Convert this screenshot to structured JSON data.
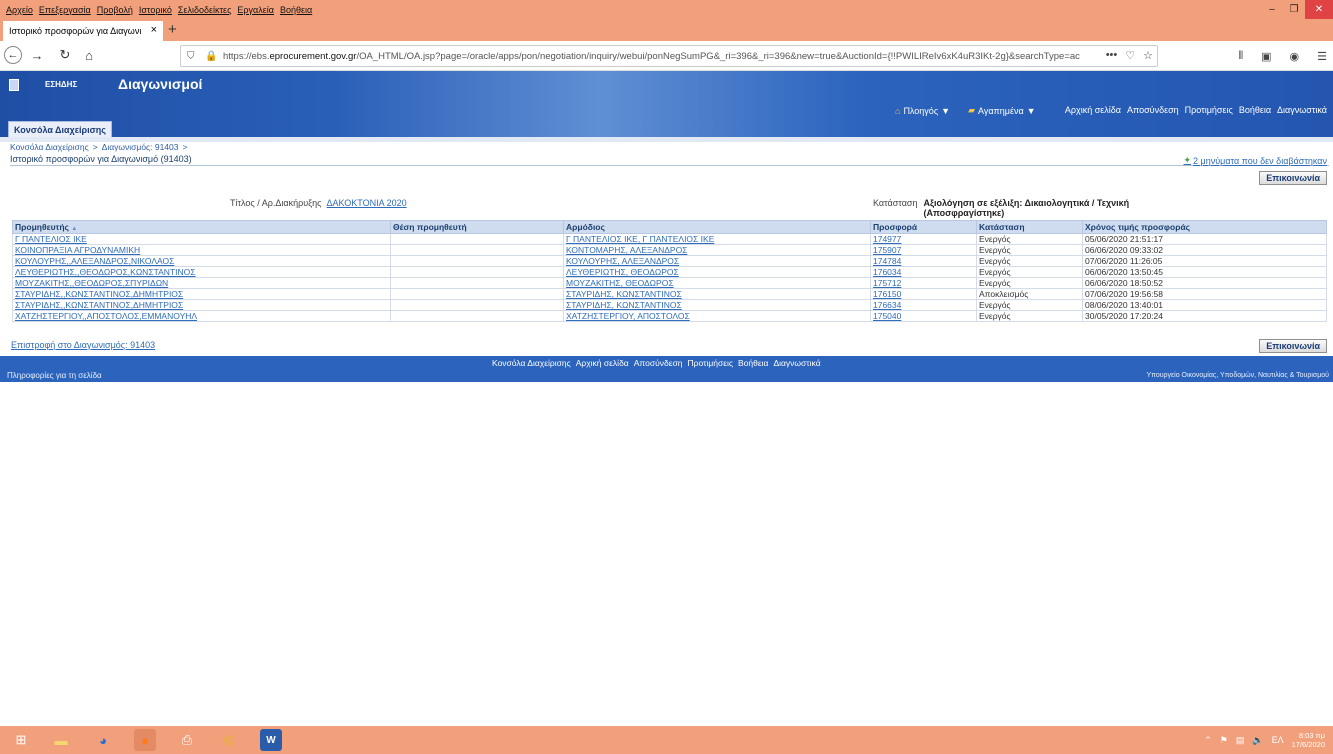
{
  "browser": {
    "menu": [
      "Αρχείο",
      "Επεξεργασία",
      "Προβολή",
      "Ιστορικό",
      "Σελιδοδείκτες",
      "Εργαλεία",
      "Βοήθεια"
    ],
    "tab_title": "Ιστορικό προσφορών για Διαγωνι",
    "url_prefix": "https://ebs.",
    "url_domain": "eprocurement.gov.gr",
    "url_rest": "/OA_HTML/OA.jsp?page=/oracle/apps/pon/negotiation/inquiry/webui/ponNegSumPG&_ri=396&_ri=396&new=true&AuctionId={!!PWILIReIv6xK4uR3IKt-2g}&searchType=ac",
    "url_more": "•••"
  },
  "header": {
    "brand": "ΕΣΗΔΗΣ",
    "app_title": "Διαγωνισμοί",
    "navigator": "Πλοηγός",
    "favorites": "Αγαπημένα",
    "top_links": [
      "Αρχική σελίδα",
      "Αποσύνδεση",
      "Προτιμήσεις",
      "Βοήθεια",
      "Διαγνωστικά"
    ],
    "console_tab": "Κονσόλα Διαχείρισης"
  },
  "page": {
    "breadcrumb": [
      "Κονσόλα Διαχείρισης",
      ">",
      "Διαγωνισμός: 91403",
      ">"
    ],
    "title": "Ιστορικό προσφορών για Διαγωνισμό (91403)",
    "unread_messages": "2 μηνύματα που δεν διαβάστηκαν",
    "communication_button": "Επικοινωνία",
    "tender_label": "Τίτλος / Αρ.Διακήρυξης",
    "tender_value": "ΔΑΚΟΚΤΟΝΙΑ 2020",
    "status_label": "Κατάσταση",
    "status_value": "Αξιολόγηση σε εξέλιξη: Δικαιολογητικά / Τεχνική (Αποσφραγίστηκε)",
    "return_link": "Επιστροφή στο Διαγωνισμός: 91403"
  },
  "table": {
    "headers": [
      "Προμηθευτής",
      "Θέση προμηθευτή",
      "Αρμόδιος",
      "Προσφορά",
      "Κατάσταση",
      "Χρόνος τιμής προσφοράς"
    ],
    "sort_indicator": "▲",
    "rows": [
      [
        "Γ ΠΑΝΤΕΛΙΟΣ ΙΚΕ",
        "",
        "Γ ΠΑΝΤΕΛΙΟΣ ΙΚΕ, Γ ΠΑΝΤΕΛΙΟΣ ΙΚΕ",
        "174977",
        "Ενεργός",
        "05/06/2020 21:51:17"
      ],
      [
        "ΚΟΙΝΟΠΡΑΞΙΑ ΑΓΡΟΔΥΝΑΜΙΚΗ",
        "",
        "ΚΟΝΤΟΜΑΡΗΣ, ΑΛΕΞΑΝΔΡΟΣ",
        "175907",
        "Ενεργός",
        "06/06/2020 09:33:02"
      ],
      [
        "ΚΟΥΛΟΥΡΗΣ,,ΑΛΕΞΑΝΔΡΟΣ,ΝΙΚΟΛΑΟΣ",
        "",
        "ΚΟΥΛΟΥΡΗΣ, ΑΛΕΞΑΝΔΡΟΣ",
        "174784",
        "Ενεργός",
        "07/06/2020 11:26:05"
      ],
      [
        "ΛΕΥΘΕΡΙΩΤΗΣ,,ΘΕΟΔΩΡΟΣ,ΚΩΝΣΤΑΝΤΙΝΟΣ",
        "",
        "ΛΕΥΘΕΡΙΩΤΗΣ, ΘΕΟΔΩΡΟΣ",
        "176034",
        "Ενεργός",
        "06/06/2020 13:50:45"
      ],
      [
        "ΜΟΥΖΑΚΙΤΗΣ,,ΘΕΟΔΩΡΟΣ,ΣΠΥΡΙΔΩΝ",
        "",
        "ΜΟΥΖΑΚΙΤΗΣ, ΘΕΟΔΩΡΟΣ",
        "175712",
        "Ενεργός",
        "06/06/2020 18:50:52"
      ],
      [
        "ΣΤΑΥΡΙΔΗΣ,,ΚΩΝΣΤΑΝΤΙΝΟΣ,ΔΗΜΗΤΡΙΟΣ",
        "",
        "ΣΤΑΥΡΙΔΗΣ, ΚΩΝΣΤΑΝΤΙΝΟΣ",
        "176150",
        "Αποκλεισμός",
        "07/06/2020 19:56:58"
      ],
      [
        "ΣΤΑΥΡΙΔΗΣ,,ΚΩΝΣΤΑΝΤΙΝΟΣ,ΔΗΜΗΤΡΙΟΣ",
        "",
        "ΣΤΑΥΡΙΔΗΣ, ΚΩΝΣΤΑΝΤΙΝΟΣ",
        "176634",
        "Ενεργός",
        "08/06/2020 13:40:01"
      ],
      [
        "ΧΑΤΖΗΣΤΕΡΓΙΟΥ,,ΑΠΟΣΤΟΛΟΣ,ΕΜΜΑΝΟΥΗΛ",
        "",
        "ΧΑΤΖΗΣΤΕΡΓΙΟΥ, ΑΠΟΣΤΟΛΟΣ",
        "175040",
        "Ενεργός",
        "30/05/2020 17:20:24"
      ]
    ]
  },
  "footer": {
    "links": [
      "Κονσόλα Διαχείρισης",
      "Αρχική σελίδα",
      "Αποσύνδεση",
      "Προτιμήσεις",
      "Βοήθεια",
      "Διαγνωστικά"
    ],
    "page_info": "Πληροφορίες για τη σελίδα",
    "ministry": "Υπουργείο Οικονομίας, Υποδομών, Ναυτιλίας & Τουρισμού"
  },
  "taskbar": {
    "language": "ΕΛ",
    "time": "8:03 πμ",
    "date": "17/6/2020"
  },
  "colors": {
    "header_blue": "#2b63bd",
    "link_blue": "#2f6cba",
    "firefox_chrome": "#f2a07b"
  }
}
